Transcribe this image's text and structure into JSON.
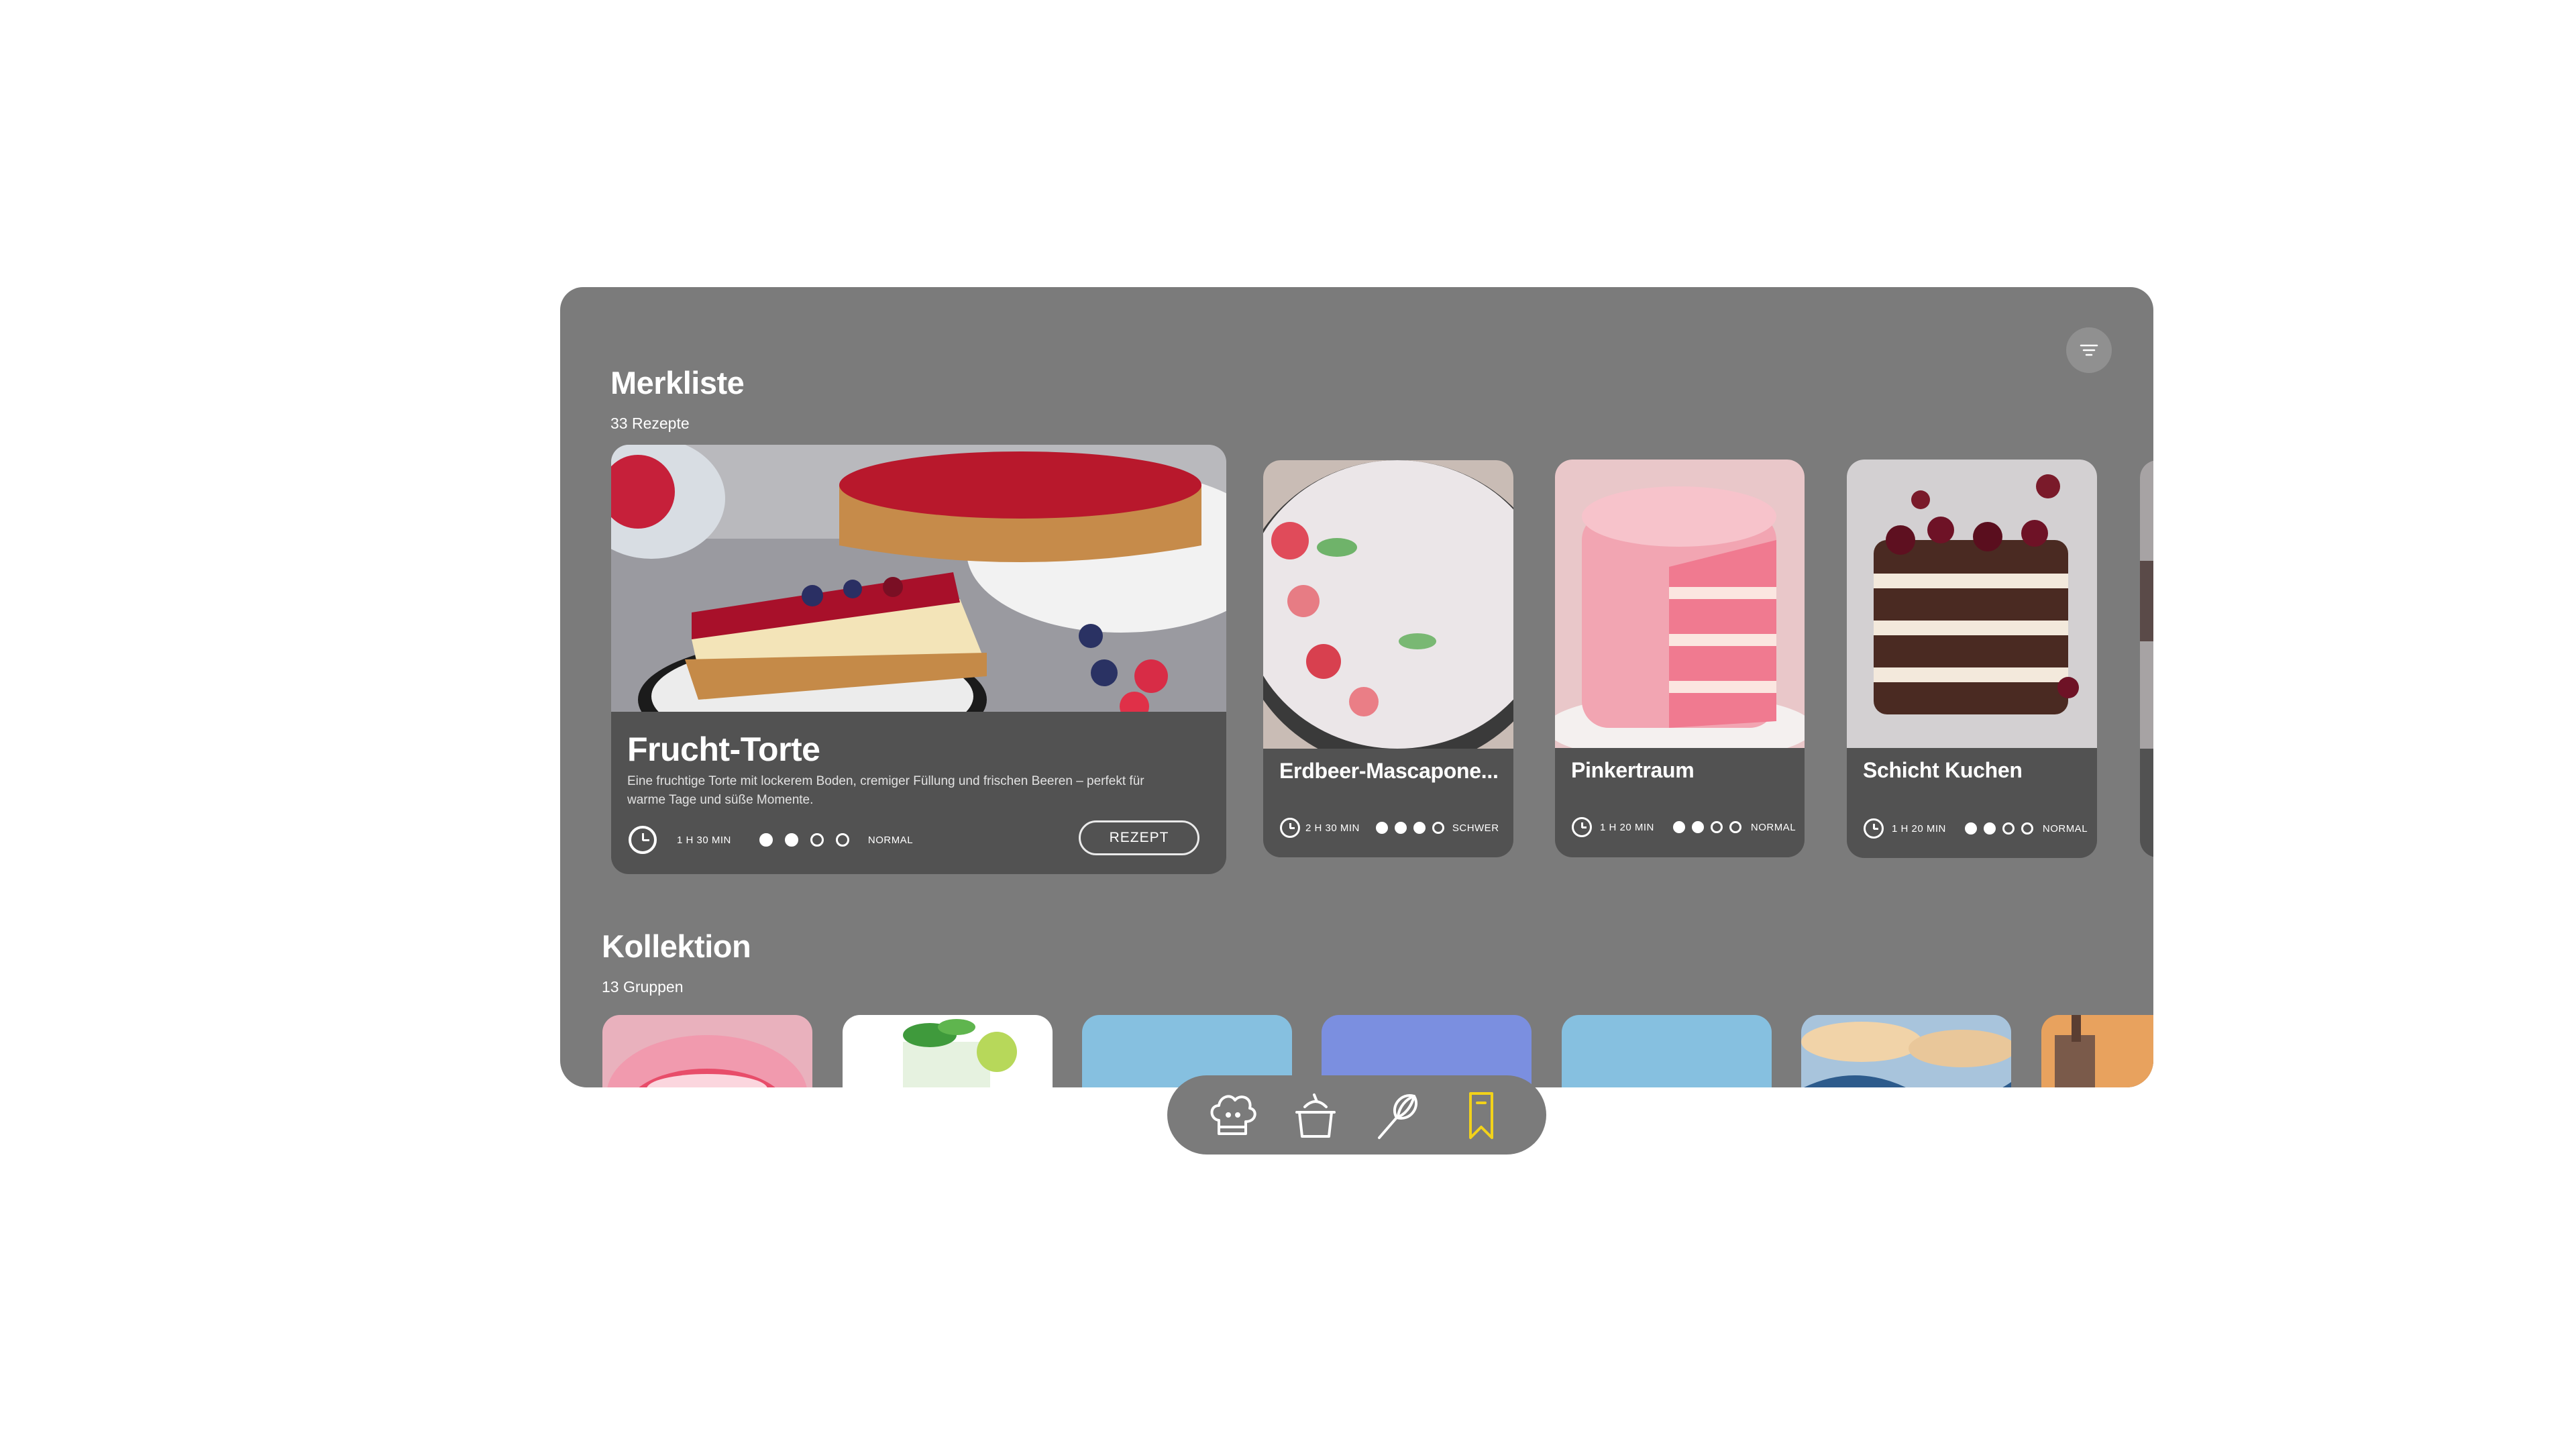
{
  "watchlist": {
    "title": "Merkliste",
    "subtitle": "33 Rezepte",
    "filter_icon": "filter-lines-icon"
  },
  "featured": {
    "name": "Frucht-Torte",
    "description": "Eine fruchtige Torte mit lockerem Boden, cremiger Füllung und frischen Beeren – perfekt für warme Tage und süße Momente.",
    "time": "1 H 30 MIN",
    "difficulty_level": 2,
    "difficulty_max": 4,
    "difficulty": "NORMAL",
    "button_label": "REZEPT"
  },
  "recipes": [
    {
      "name": "Erdbeer-Mascapone...",
      "time": "2 H 30 MIN",
      "difficulty_level": 3,
      "difficulty_max": 4,
      "difficulty": "SCHWER"
    },
    {
      "name": "Pinkertraum",
      "time": "1 H 20 MIN",
      "difficulty_level": 2,
      "difficulty_max": 4,
      "difficulty": "NORMAL"
    },
    {
      "name": "Schicht Kuchen",
      "time": "1 H 20 MIN",
      "difficulty_level": 2,
      "difficulty_max": 4,
      "difficulty": "NORMAL"
    }
  ],
  "collection": {
    "title": "Kollektion",
    "subtitle": "13 Gruppen",
    "colors": [
      "#f0a3b8",
      "#ffffff",
      "#86c0e0",
      "#7b8fe0",
      "#86c0e0",
      "#6b8fbf",
      "#d98c4a"
    ]
  },
  "dock": {
    "items": [
      {
        "icon": "chef-hat-icon",
        "active": false
      },
      {
        "icon": "cooking-pot-icon",
        "active": false
      },
      {
        "icon": "whisk-icon",
        "active": false
      },
      {
        "icon": "bookmark-icon",
        "active": true
      }
    ],
    "accent": "#f2d21a"
  }
}
